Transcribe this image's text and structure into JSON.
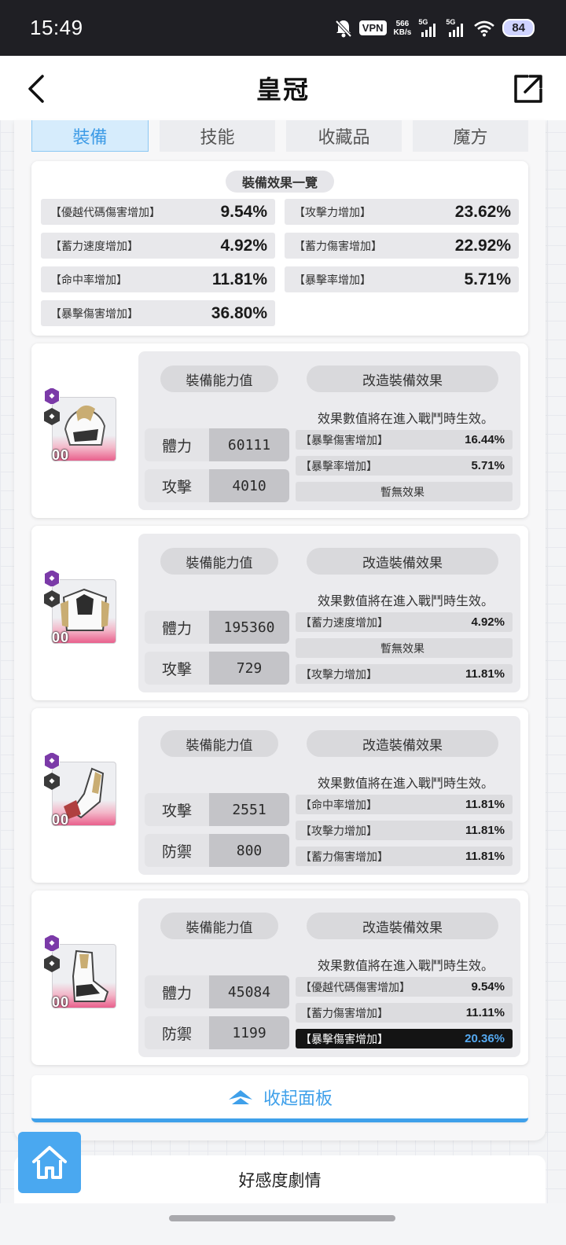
{
  "status_bar": {
    "time": "15:49",
    "vpn": "VPN",
    "speed_value": "566",
    "speed_unit": "KB/s",
    "signal_1": "5G",
    "signal_2": "5G",
    "battery": "84",
    "icons": [
      "bell-off-icon",
      "wifi-icon"
    ]
  },
  "header": {
    "title": "皇冠",
    "back_icon": "chevron-left-icon",
    "share_icon": "external-link-icon"
  },
  "tabs": [
    {
      "label": "裝備",
      "active": true
    },
    {
      "label": "技能",
      "active": false
    },
    {
      "label": "收藏品",
      "active": false
    },
    {
      "label": "魔方",
      "active": false
    }
  ],
  "summary": {
    "title": "裝備效果一覽",
    "rows": [
      {
        "label": "【優越代碼傷害增加】",
        "value": "9.54%"
      },
      {
        "label": "【攻擊力增加】",
        "value": "23.62%"
      },
      {
        "label": "【蓄力速度增加】",
        "value": "4.92%"
      },
      {
        "label": "【蓄力傷害增加】",
        "value": "22.92%"
      },
      {
        "label": "【命中率增加】",
        "value": "11.81%"
      },
      {
        "label": "【暴擊率增加】",
        "value": "5.71%"
      },
      {
        "label": "【暴擊傷害增加】",
        "value": "36.80%"
      }
    ]
  },
  "equipment_labels": {
    "stats_title": "裝備能力值",
    "effects_title": "改造裝備效果",
    "note": "效果數值將在進入戰鬥時生效。",
    "level": "00"
  },
  "equipment": [
    {
      "stats": [
        {
          "label": "體力",
          "value": "60111"
        },
        {
          "label": "攻擊",
          "value": "4010"
        }
      ],
      "effects": [
        {
          "label": "【暴擊傷害增加】",
          "value": "16.44%"
        },
        {
          "label": "【暴擊率增加】",
          "value": "5.71%"
        },
        {
          "label": "暫無效果",
          "value": ""
        }
      ]
    },
    {
      "stats": [
        {
          "label": "體力",
          "value": "195360"
        },
        {
          "label": "攻擊",
          "value": "729"
        }
      ],
      "effects": [
        {
          "label": "【蓄力速度增加】",
          "value": "4.92%"
        },
        {
          "label": "暫無效果",
          "value": ""
        },
        {
          "label": "【攻擊力增加】",
          "value": "11.81%"
        }
      ]
    },
    {
      "stats": [
        {
          "label": "攻擊",
          "value": "2551"
        },
        {
          "label": "防禦",
          "value": "800"
        }
      ],
      "effects": [
        {
          "label": "【命中率增加】",
          "value": "11.81%"
        },
        {
          "label": "【攻擊力增加】",
          "value": "11.81%"
        },
        {
          "label": "【蓄力傷害增加】",
          "value": "11.81%"
        }
      ]
    },
    {
      "stats": [
        {
          "label": "體力",
          "value": "45084"
        },
        {
          "label": "防禦",
          "value": "1199"
        }
      ],
      "effects": [
        {
          "label": "【優越代碼傷害增加】",
          "value": "9.54%"
        },
        {
          "label": "【蓄力傷害增加】",
          "value": "11.11%"
        },
        {
          "label": "【暴擊傷害增加】",
          "value": "20.36%",
          "highlighted": true
        }
      ]
    }
  ],
  "collapse": {
    "label": "收起面板",
    "icon": "chevron-up-icon"
  },
  "home": {
    "icon": "home-icon"
  },
  "bottom_section": {
    "label": "好感度劇情"
  },
  "colors": {
    "accent": "#3fa0ea",
    "status_bar": "#1f1f24",
    "highlight_value": "#55a9f0"
  }
}
